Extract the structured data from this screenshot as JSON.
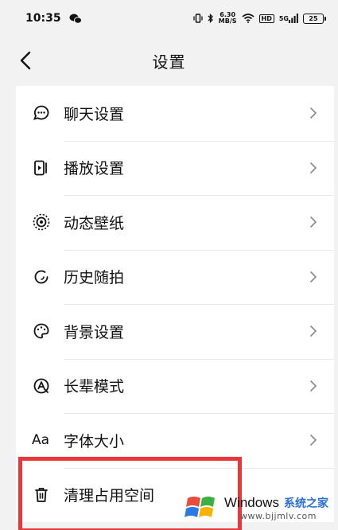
{
  "status_bar": {
    "time": "10:35",
    "net_speed_value": "6.30",
    "net_speed_unit": "MB/S",
    "hd_label": "HD",
    "signal_label": "5G",
    "battery_level": "25",
    "icons": [
      "wechat-icon",
      "vibrate-icon",
      "bluetooth-icon",
      "wifi-icon",
      "signal-icon",
      "battery-icon"
    ]
  },
  "header": {
    "title": "设置"
  },
  "settings": {
    "items": [
      {
        "label": "聊天设置",
        "icon": "chat-bubble-icon"
      },
      {
        "label": "播放设置",
        "icon": "play-settings-icon"
      },
      {
        "label": "动态壁纸",
        "icon": "dynamic-wallpaper-icon"
      },
      {
        "label": "历史随拍",
        "icon": "history-icon"
      },
      {
        "label": "背景设置",
        "icon": "palette-icon"
      },
      {
        "label": "长辈模式",
        "icon": "elder-mode-icon"
      },
      {
        "label": "字体大小",
        "icon": "font-size-icon"
      },
      {
        "label": "清理占用空间",
        "icon": "trash-icon"
      }
    ],
    "font_icon_text": "Aa"
  },
  "watermark": {
    "brand": "Windows",
    "site_name": "系统之家",
    "url": "www.bjjmlv.com"
  },
  "colors": {
    "background": "#f2f2f2",
    "card": "#ffffff",
    "highlight": "#e8383c",
    "watermark_blue": "#2a6fd6"
  }
}
